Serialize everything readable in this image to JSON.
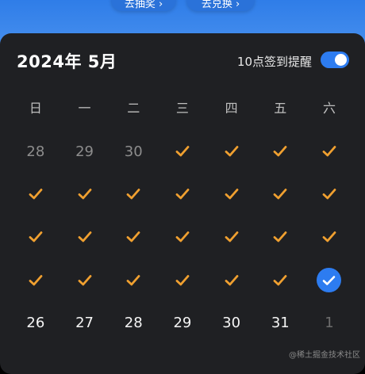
{
  "top_buttons": [
    "去抽奖 ›",
    "去兑换 ›"
  ],
  "calendar": {
    "title": "2024年 5月",
    "reminder_label": "10点签到提醒",
    "reminder_on": true,
    "weekdays": [
      "日",
      "一",
      "二",
      "三",
      "四",
      "五",
      "六"
    ],
    "cells": [
      {
        "type": "text",
        "text": "28",
        "tone": "muted"
      },
      {
        "type": "text",
        "text": "29",
        "tone": "muted"
      },
      {
        "type": "text",
        "text": "30",
        "tone": "muted"
      },
      {
        "type": "check"
      },
      {
        "type": "check"
      },
      {
        "type": "check"
      },
      {
        "type": "check"
      },
      {
        "type": "check"
      },
      {
        "type": "check"
      },
      {
        "type": "check"
      },
      {
        "type": "check"
      },
      {
        "type": "check"
      },
      {
        "type": "check"
      },
      {
        "type": "check"
      },
      {
        "type": "check"
      },
      {
        "type": "check"
      },
      {
        "type": "check"
      },
      {
        "type": "check"
      },
      {
        "type": "check"
      },
      {
        "type": "check"
      },
      {
        "type": "check"
      },
      {
        "type": "check"
      },
      {
        "type": "check"
      },
      {
        "type": "check"
      },
      {
        "type": "check"
      },
      {
        "type": "check"
      },
      {
        "type": "check"
      },
      {
        "type": "today"
      },
      {
        "type": "text",
        "text": "26",
        "tone": "bright"
      },
      {
        "type": "text",
        "text": "27",
        "tone": "bright"
      },
      {
        "type": "text",
        "text": "28",
        "tone": "bright"
      },
      {
        "type": "text",
        "text": "29",
        "tone": "bright"
      },
      {
        "type": "text",
        "text": "30",
        "tone": "bright"
      },
      {
        "type": "text",
        "text": "31",
        "tone": "bright"
      },
      {
        "type": "text",
        "text": "1",
        "tone": "faded"
      }
    ]
  },
  "colors": {
    "check": "#f0a030",
    "accent": "#2d7cf0",
    "card_bg": "#1f2023"
  },
  "watermark": "@稀土掘金技术社区"
}
